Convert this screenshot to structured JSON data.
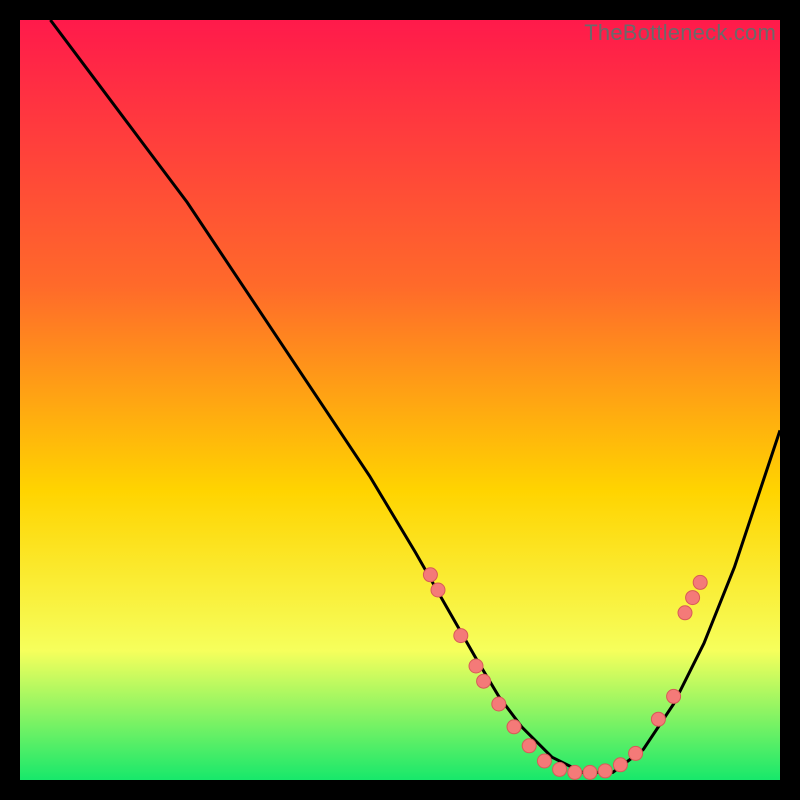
{
  "watermark": "TheBottleneck.com",
  "colors": {
    "gradient_top": "#ff1a4b",
    "gradient_mid1": "#ff6a2a",
    "gradient_mid2": "#ffd400",
    "gradient_mid3": "#f6ff5c",
    "gradient_bottom": "#17e86b",
    "curve": "#000000",
    "marker_fill": "#f47a78",
    "marker_stroke": "#d85a58"
  },
  "chart_data": {
    "type": "line",
    "title": "",
    "xlabel": "",
    "ylabel": "",
    "xlim": [
      0,
      100
    ],
    "ylim": [
      0,
      100
    ],
    "series": [
      {
        "name": "bottleneck-curve",
        "x": [
          4,
          10,
          16,
          22,
          28,
          34,
          40,
          46,
          52,
          56,
          60,
          63,
          66,
          70,
          74,
          78,
          82,
          86,
          90,
          94,
          98,
          100
        ],
        "y": [
          100,
          92,
          84,
          76,
          67,
          58,
          49,
          40,
          30,
          23,
          16,
          11,
          7,
          3,
          1,
          1,
          4,
          10,
          18,
          28,
          40,
          46
        ]
      }
    ],
    "markers": [
      {
        "x": 54,
        "y": 27
      },
      {
        "x": 55,
        "y": 25
      },
      {
        "x": 58,
        "y": 19
      },
      {
        "x": 60,
        "y": 15
      },
      {
        "x": 61,
        "y": 13
      },
      {
        "x": 63,
        "y": 10
      },
      {
        "x": 65,
        "y": 7
      },
      {
        "x": 67,
        "y": 4.5
      },
      {
        "x": 69,
        "y": 2.5
      },
      {
        "x": 71,
        "y": 1.4
      },
      {
        "x": 73,
        "y": 1
      },
      {
        "x": 75,
        "y": 1
      },
      {
        "x": 77,
        "y": 1.2
      },
      {
        "x": 79,
        "y": 2
      },
      {
        "x": 81,
        "y": 3.5
      },
      {
        "x": 84,
        "y": 8
      },
      {
        "x": 86,
        "y": 11
      },
      {
        "x": 87.5,
        "y": 22
      },
      {
        "x": 88.5,
        "y": 24
      },
      {
        "x": 89.5,
        "y": 26
      }
    ]
  }
}
